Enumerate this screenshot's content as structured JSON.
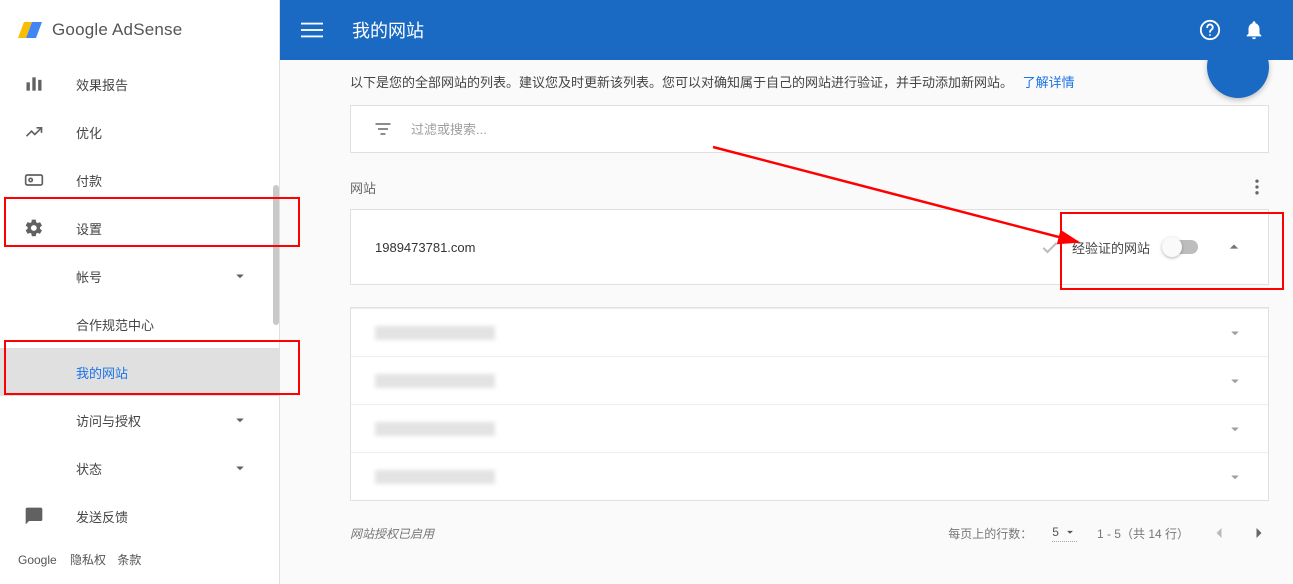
{
  "logo": {
    "text": "Google AdSense"
  },
  "topbar": {
    "title": "我的网站"
  },
  "sidebar": {
    "items": [
      {
        "label": "效果报告"
      },
      {
        "label": "优化"
      },
      {
        "label": "付款"
      },
      {
        "label": "设置"
      },
      {
        "label": "帐号"
      },
      {
        "label": "合作规范中心"
      },
      {
        "label": "我的网站"
      },
      {
        "label": "访问与授权"
      },
      {
        "label": "状态"
      },
      {
        "label": "发送反馈"
      }
    ]
  },
  "footer": {
    "brand": "Google",
    "privacy": "隐私权",
    "terms": "条款"
  },
  "main": {
    "description": "以下是您的全部网站的列表。建议您及时更新该列表。您可以对确知属于自己的网站进行验证，并手动添加新网站。",
    "learn_more": "了解详情",
    "search_placeholder": "过滤或搜索...",
    "section_title": "网站",
    "site": {
      "domain": "1989473781.com",
      "verified_label": "经验证的网站"
    },
    "authorized_note": "网站授权已启用",
    "pager": {
      "rows_label": "每页上的行数：",
      "page_size": "5",
      "range": "1 - 5（共 14 行）"
    }
  }
}
